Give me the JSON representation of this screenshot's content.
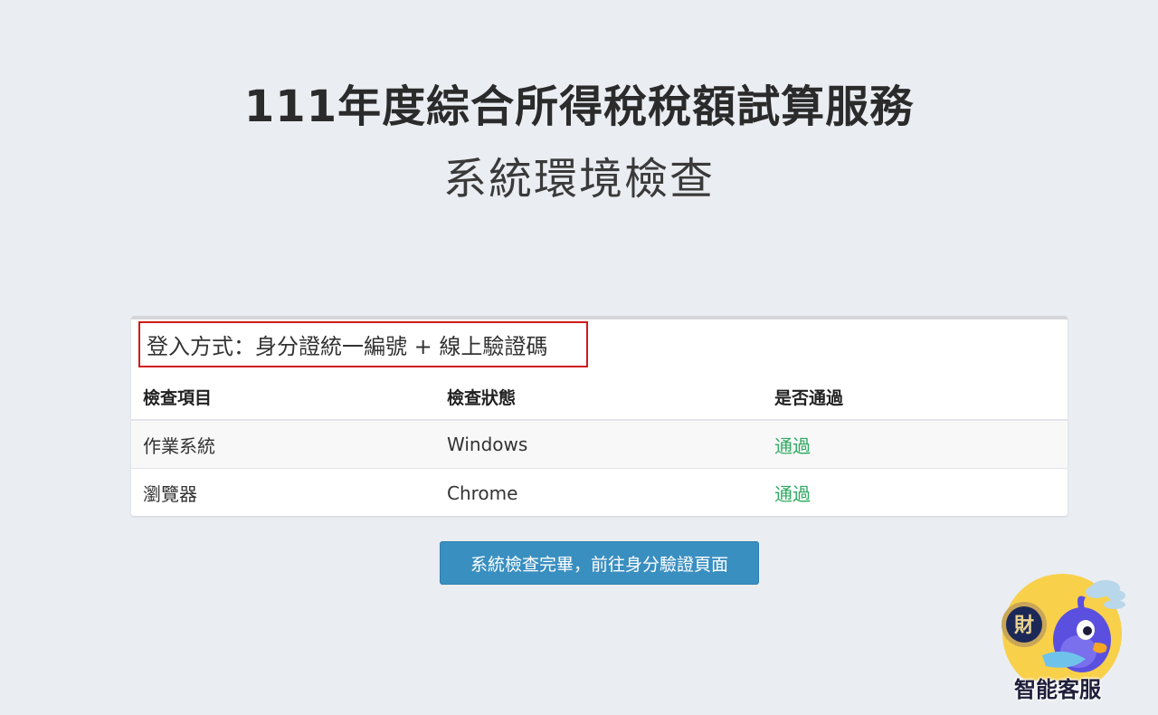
{
  "header": {
    "title": "111年度綜合所得稅稅額試算服務",
    "subtitle": "系統環境檢查"
  },
  "login": {
    "text": "登入方式：身分證統一編號 + 線上驗證碼"
  },
  "table": {
    "headers": [
      "檢查項目",
      "檢查狀態",
      "是否通過"
    ],
    "rows": [
      {
        "item": "作業系統",
        "status": "Windows",
        "pass": "通過"
      },
      {
        "item": "瀏覽器",
        "status": "Chrome",
        "pass": "通過"
      }
    ]
  },
  "actions": {
    "proceed_label": "系統檢查完畢，前往身分驗證頁面"
  },
  "chatbot": {
    "label": "智能客服",
    "seal_text": "財"
  },
  "colors": {
    "pass": "#2eaa62",
    "button": "#3a8fc1",
    "highlight_border": "#d01a1a"
  }
}
